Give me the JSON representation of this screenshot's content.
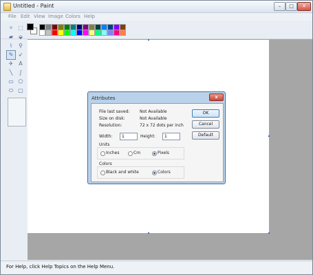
{
  "window": {
    "title": "Untitled - Paint"
  },
  "caption_buttons": {
    "minimize": "–",
    "maximize": "□",
    "close": "✕"
  },
  "menu": [
    "File",
    "Edit",
    "View",
    "Image",
    "Colors",
    "Help"
  ],
  "palette": {
    "foreground": "#000000",
    "background": "#ffffff",
    "top_row": [
      "#000000",
      "#808080",
      "#800000",
      "#808000",
      "#008000",
      "#008080",
      "#000080",
      "#800080",
      "#808040",
      "#004040",
      "#0080ff",
      "#004080",
      "#8000ff",
      "#804000"
    ],
    "bottom_row": [
      "#ffffff",
      "#c0c0c0",
      "#ff0000",
      "#ffff00",
      "#00ff00",
      "#00ffff",
      "#0000ff",
      "#ff00ff",
      "#ffff80",
      "#00ff80",
      "#80ffff",
      "#8080ff",
      "#ff0080",
      "#ff8040"
    ]
  },
  "tools": [
    {
      "name": "free-form-select-icon",
      "glyph": "✧"
    },
    {
      "name": "select-icon",
      "glyph": "⬚"
    },
    {
      "name": "eraser-icon",
      "glyph": "▰"
    },
    {
      "name": "fill-icon",
      "glyph": "⬙"
    },
    {
      "name": "color-picker-icon",
      "glyph": "⌇"
    },
    {
      "name": "magnifier-icon",
      "glyph": "⚲"
    },
    {
      "name": "pencil-icon",
      "glyph": "✎"
    },
    {
      "name": "brush-icon",
      "glyph": "➶"
    },
    {
      "name": "airbrush-icon",
      "glyph": "✈"
    },
    {
      "name": "text-icon",
      "glyph": "A"
    },
    {
      "name": "line-icon",
      "glyph": "╲"
    },
    {
      "name": "curve-icon",
      "glyph": "∫"
    },
    {
      "name": "rectangle-icon",
      "glyph": "▭"
    },
    {
      "name": "polygon-icon",
      "glyph": "⬠"
    },
    {
      "name": "ellipse-icon",
      "glyph": "⬭"
    },
    {
      "name": "rounded-rectangle-icon",
      "glyph": "▢"
    }
  ],
  "status_bar": {
    "text": "For Help, click Help Topics on the Help Menu."
  },
  "dialog": {
    "title": "Attributes",
    "close_label": "x",
    "file_last_saved_label": "File last saved:",
    "file_last_saved_value": "Not Available",
    "size_on_disk_label": "Size on disk:",
    "size_on_disk_value": "Not Available",
    "resolution_label": "Resolution:",
    "resolution_value": "72 x 72 dots per inch",
    "width_label": "Width:",
    "width_value": "1",
    "height_label": "Height:",
    "height_value": "1",
    "units_label": "Units",
    "units_options": [
      "Inches",
      "Cm",
      "Pixels"
    ],
    "units_selected": "Pixels",
    "colors_label": "Colors",
    "colors_options": [
      "Black and white",
      "Colors"
    ],
    "colors_selected": "Colors",
    "ok_label": "OK",
    "cancel_label": "Cancel",
    "default_label": "Default"
  }
}
